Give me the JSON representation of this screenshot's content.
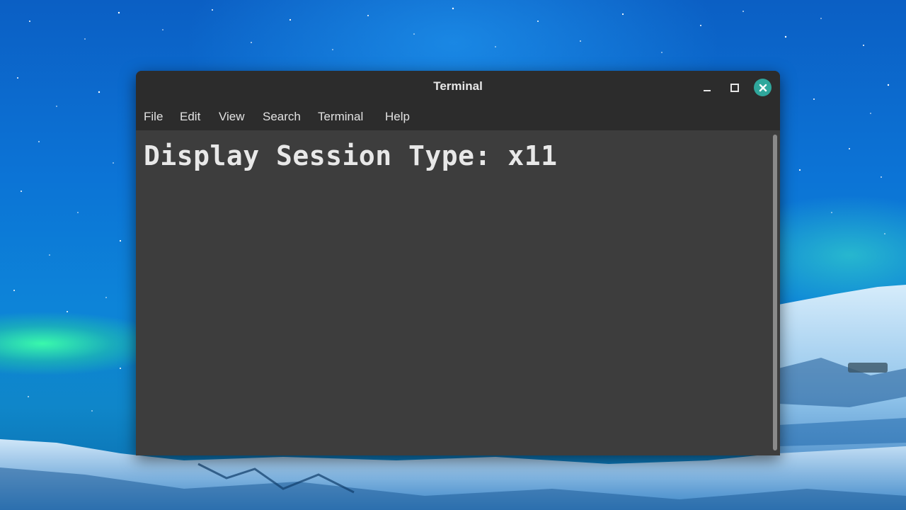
{
  "window": {
    "title": "Terminal",
    "controls": {
      "minimize_icon": "minimize-icon",
      "maximize_icon": "maximize-icon",
      "close_icon": "close-icon"
    }
  },
  "menubar": {
    "items": [
      {
        "label": "File"
      },
      {
        "label": "Edit"
      },
      {
        "label": "View"
      },
      {
        "label": "Search"
      },
      {
        "label": "Terminal"
      },
      {
        "label": "Help"
      }
    ]
  },
  "terminal": {
    "output": "Display Session Type: x11"
  },
  "colors": {
    "titlebar": "#2c2c2c",
    "terminal_bg": "#3d3d3d",
    "close_button": "#2fa79c",
    "text": "#e8e8e8"
  }
}
